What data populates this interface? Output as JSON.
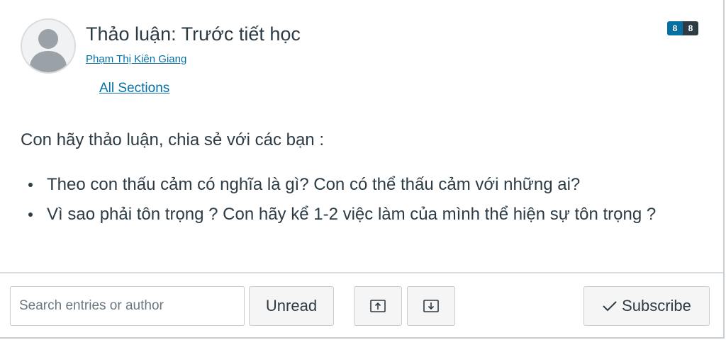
{
  "topic": {
    "title": "Thảo luận: Trước tiết học",
    "author": "Phạm Thị Kiên Giang",
    "sections_link": "All Sections",
    "badges": {
      "unread": "8",
      "total": "8"
    }
  },
  "message": {
    "intro": "Con hãy thảo luận, chia sẻ với các bạn :",
    "bullets": [
      "Theo con thấu cảm có nghĩa là gì? Con có thể thấu cảm với những ai?",
      "Vì sao phải tôn trọng ? Con hãy kể 1-2 việc làm của mình thể hiện sự tôn trọng ?"
    ]
  },
  "toolbar": {
    "search_placeholder": "Search entries or author",
    "unread_label": "Unread",
    "expand_icon": "arrow-up-tray-icon",
    "collapse_icon": "arrow-down-tray-icon",
    "subscribe_label": "Subscribe"
  },
  "colors": {
    "link": "#0770a3",
    "text": "#2d3b45",
    "badge_unread": "#0770a3",
    "badge_total": "#2d3b45"
  }
}
